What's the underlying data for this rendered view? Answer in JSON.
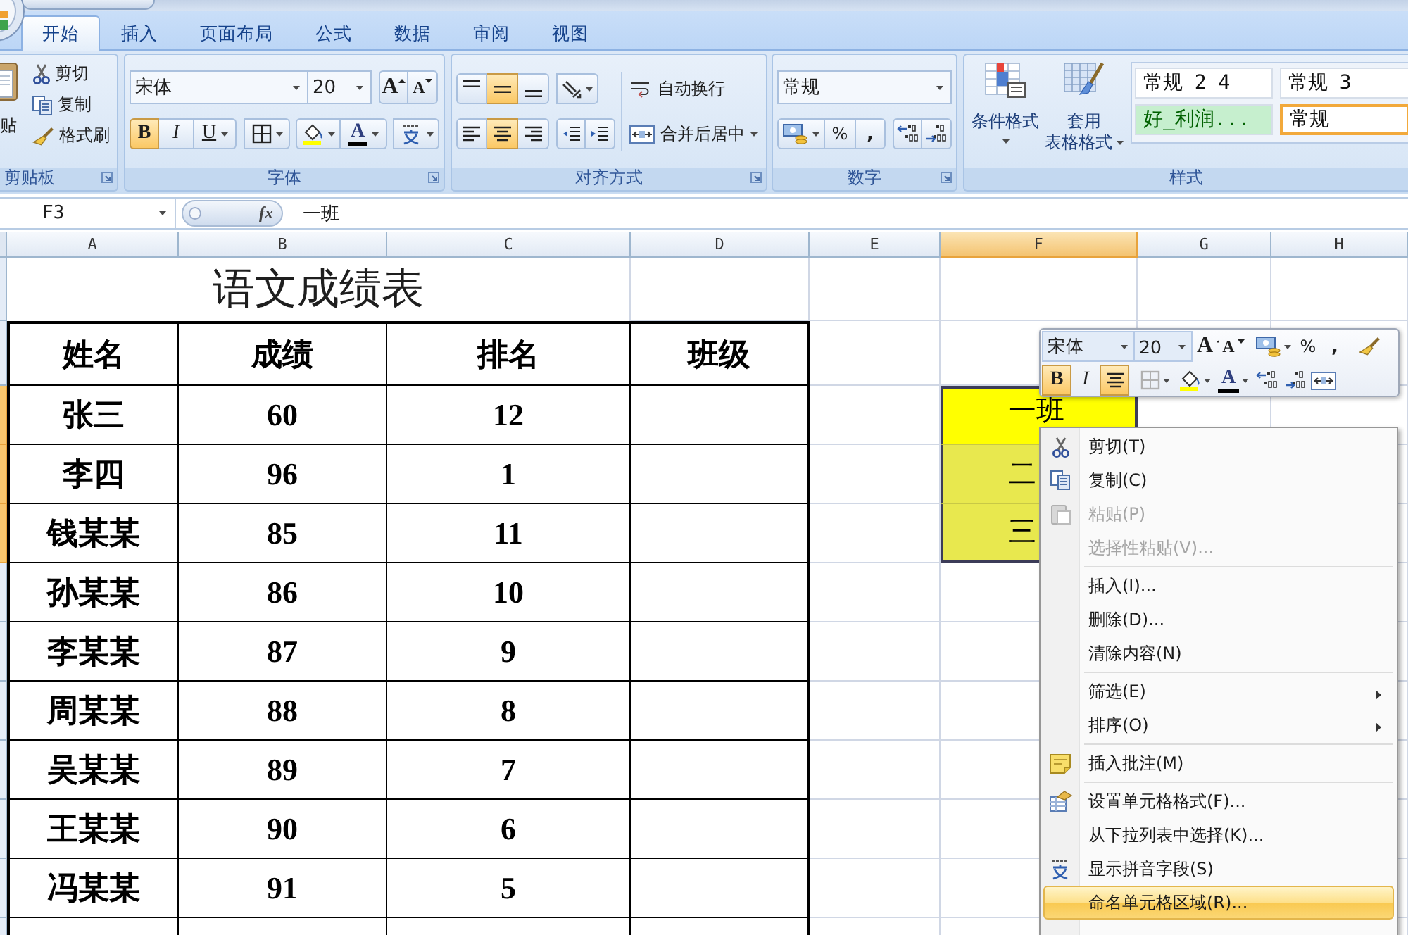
{
  "tabs": [
    {
      "label": "开始",
      "selected": true
    },
    {
      "label": "插入",
      "selected": false
    },
    {
      "label": "页面布局",
      "selected": false
    },
    {
      "label": "公式",
      "selected": false
    },
    {
      "label": "数据",
      "selected": false
    },
    {
      "label": "审阅",
      "selected": false
    },
    {
      "label": "视图",
      "selected": false
    }
  ],
  "ribbon": {
    "clipboard": {
      "label": "剪贴板",
      "paste": "贴",
      "cut": "剪切",
      "copy": "复制",
      "format_painter": "格式刷"
    },
    "font": {
      "label": "字体",
      "font_name": "宋体",
      "font_size": "20",
      "grow_label": "A",
      "shrink_label": "A",
      "bold_label": "B",
      "italic_label": "I",
      "underline_label": "U",
      "font_color_label": "A",
      "bold": true,
      "italic": false,
      "underline": false
    },
    "alignment": {
      "label": "对齐方式",
      "vertical": {
        "top": false,
        "middle": true,
        "bottom": false
      },
      "horizontal": {
        "left": false,
        "center": true,
        "right": false
      },
      "wrap_text": "自动换行",
      "merge_center": "合并后居中"
    },
    "number": {
      "label": "数字",
      "format": "常规",
      "percent": "%",
      "comma": ","
    },
    "styles": {
      "label": "样式",
      "conditional_format": "条件格式",
      "table_format_line_1": "套用",
      "table_format_line_2": "表格格式",
      "cell_styles": [
        {
          "label": "常规 2 4",
          "kind": "normal",
          "selected": false
        },
        {
          "label": "常规 3",
          "kind": "normal",
          "selected": false
        },
        {
          "label": "好_利润...",
          "kind": "good",
          "selected": false
        },
        {
          "label": "常规",
          "kind": "normal",
          "selected": true
        }
      ]
    }
  },
  "formula_bar": {
    "name_box": "F3",
    "function_button": "fx",
    "formula": "一班"
  },
  "sheet": {
    "columns": [
      {
        "label": "A",
        "selected": false
      },
      {
        "label": "B",
        "selected": false
      },
      {
        "label": "C",
        "selected": false
      },
      {
        "label": "D",
        "selected": false
      },
      {
        "label": "E",
        "selected": false
      },
      {
        "label": "F",
        "selected": true
      },
      {
        "label": "G",
        "selected": false
      },
      {
        "label": "H",
        "selected": false
      }
    ],
    "title": "语文成绩表",
    "header": [
      "姓名",
      "成绩",
      "排名",
      "班级"
    ],
    "rows": [
      {
        "cells": [
          "张三",
          "60",
          "12"
        ],
        "selected": true
      },
      {
        "cells": [
          "李四",
          "96",
          "1"
        ],
        "selected": true
      },
      {
        "cells": [
          "钱某某",
          "85",
          "11"
        ],
        "selected": true
      },
      {
        "cells": [
          "孙某某",
          "86",
          "10"
        ],
        "selected": false
      },
      {
        "cells": [
          "李某某",
          "87",
          "9"
        ],
        "selected": false
      },
      {
        "cells": [
          "周某某",
          "88",
          "8"
        ],
        "selected": false
      },
      {
        "cells": [
          "吴某某",
          "89",
          "7"
        ],
        "selected": false
      },
      {
        "cells": [
          "王某某",
          "90",
          "6"
        ],
        "selected": false
      },
      {
        "cells": [
          "冯某某",
          "91",
          "5"
        ],
        "selected": false
      }
    ],
    "class_cells": [
      {
        "text": "一班",
        "active": true
      },
      {
        "text": "二",
        "active": false
      },
      {
        "text": "三",
        "active": false
      }
    ]
  },
  "mini_toolbar": {
    "font_name": "宋体",
    "font_size": "20",
    "grow_label": "A",
    "shrink_label": "A",
    "percent": "%",
    "comma": ",",
    "bold_label": "B",
    "italic_label": "I",
    "font_color_label": "A",
    "bold": true,
    "italic": false,
    "center": true
  },
  "context_menu": [
    {
      "label": "剪切(T)",
      "disabled": false,
      "selected": false,
      "submenu": false,
      "separator_above": false
    },
    {
      "label": "复制(C)",
      "disabled": false,
      "selected": false,
      "submenu": false,
      "separator_above": false
    },
    {
      "label": "粘贴(P)",
      "disabled": true,
      "selected": false,
      "submenu": false,
      "separator_above": false
    },
    {
      "label": "选择性粘贴(V)...",
      "disabled": true,
      "selected": false,
      "submenu": false,
      "separator_above": false
    },
    {
      "label": "插入(I)...",
      "disabled": false,
      "selected": false,
      "submenu": false,
      "separator_above": true
    },
    {
      "label": "删除(D)...",
      "disabled": false,
      "selected": false,
      "submenu": false,
      "separator_above": false
    },
    {
      "label": "清除内容(N)",
      "disabled": false,
      "selected": false,
      "submenu": false,
      "separator_above": false
    },
    {
      "label": "筛选(E)",
      "disabled": false,
      "selected": false,
      "submenu": true,
      "separator_above": true
    },
    {
      "label": "排序(O)",
      "disabled": false,
      "selected": false,
      "submenu": true,
      "separator_above": false
    },
    {
      "label": "插入批注(M)",
      "disabled": false,
      "selected": false,
      "submenu": false,
      "separator_above": true
    },
    {
      "label": "设置单元格格式(F)...",
      "disabled": false,
      "selected": false,
      "submenu": false,
      "separator_above": true
    },
    {
      "label": "从下拉列表中选择(K)...",
      "disabled": false,
      "selected": false,
      "submenu": false,
      "separator_above": false
    },
    {
      "label": "显示拼音字段(S)",
      "disabled": false,
      "selected": false,
      "submenu": false,
      "separator_above": false
    },
    {
      "label": "命名单元格区域(R)...",
      "disabled": false,
      "selected": true,
      "submenu": false,
      "separator_above": false
    }
  ]
}
